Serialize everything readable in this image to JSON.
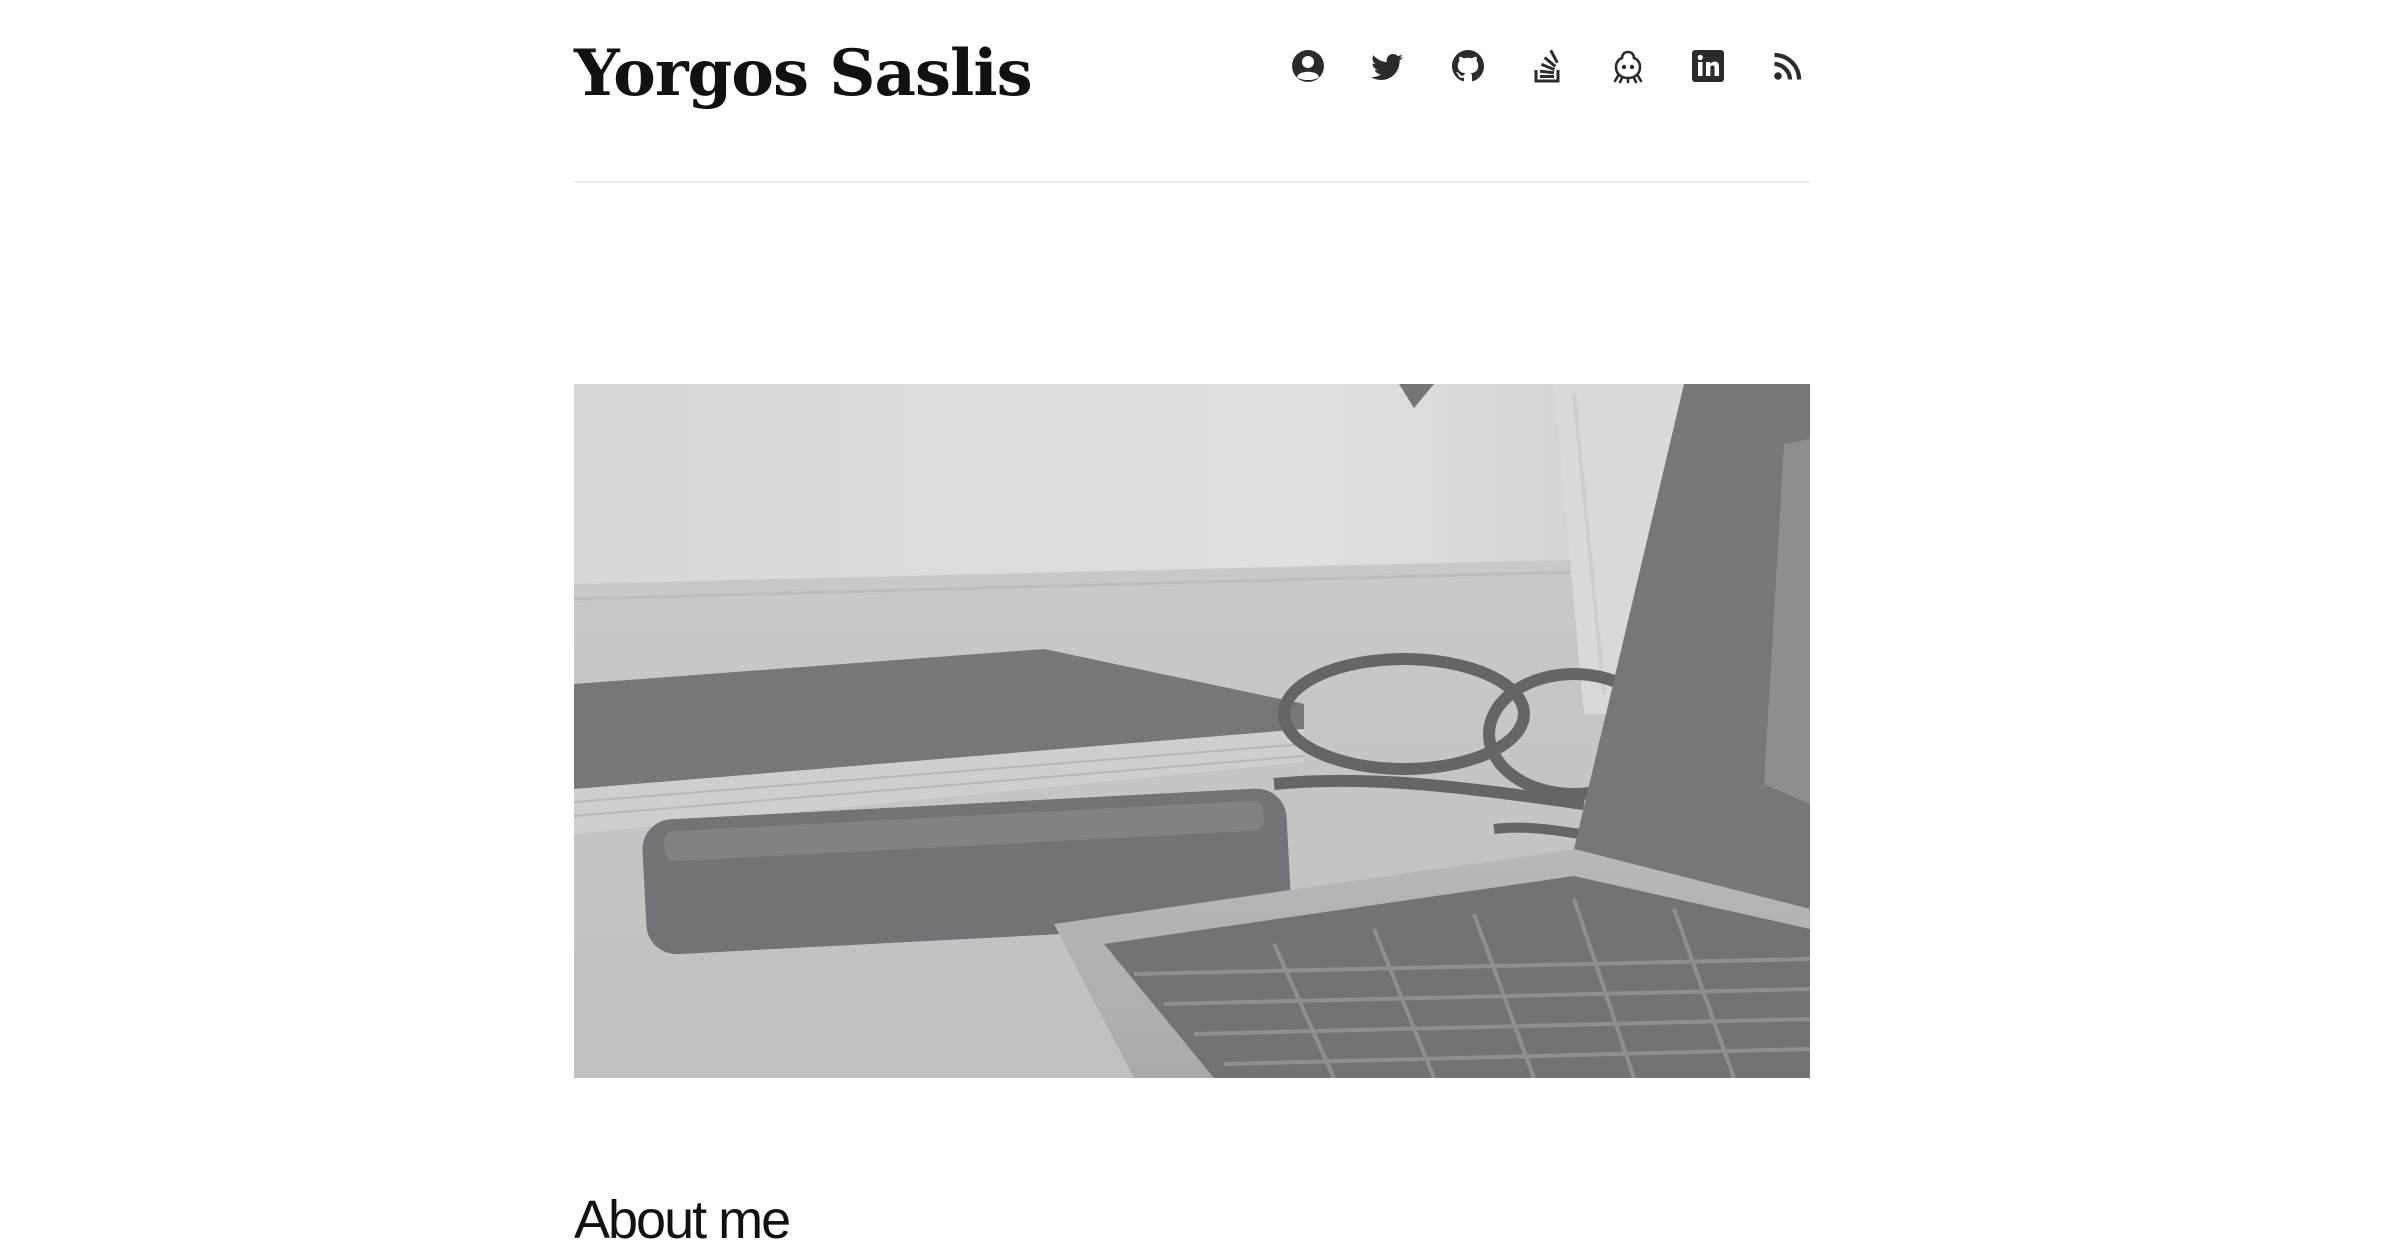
{
  "header": {
    "site_title": "Yorgos Saslis"
  },
  "social_links": [
    {
      "icon": "user-circle-icon"
    },
    {
      "icon": "twitter-icon"
    },
    {
      "icon": "github-icon"
    },
    {
      "icon": "stackoverflow-icon"
    },
    {
      "icon": "devto-octocat-icon"
    },
    {
      "icon": "linkedin-icon"
    },
    {
      "icon": "rss-icon"
    }
  ],
  "hero": {
    "image": "desk-with-notebook-phone-glasses-laptop-photo"
  },
  "main": {
    "about_heading": "About me"
  },
  "colors": {
    "text": "#111111",
    "icon": "#2b2b2b",
    "divider": "#e9e9e9",
    "background": "#ffffff"
  }
}
